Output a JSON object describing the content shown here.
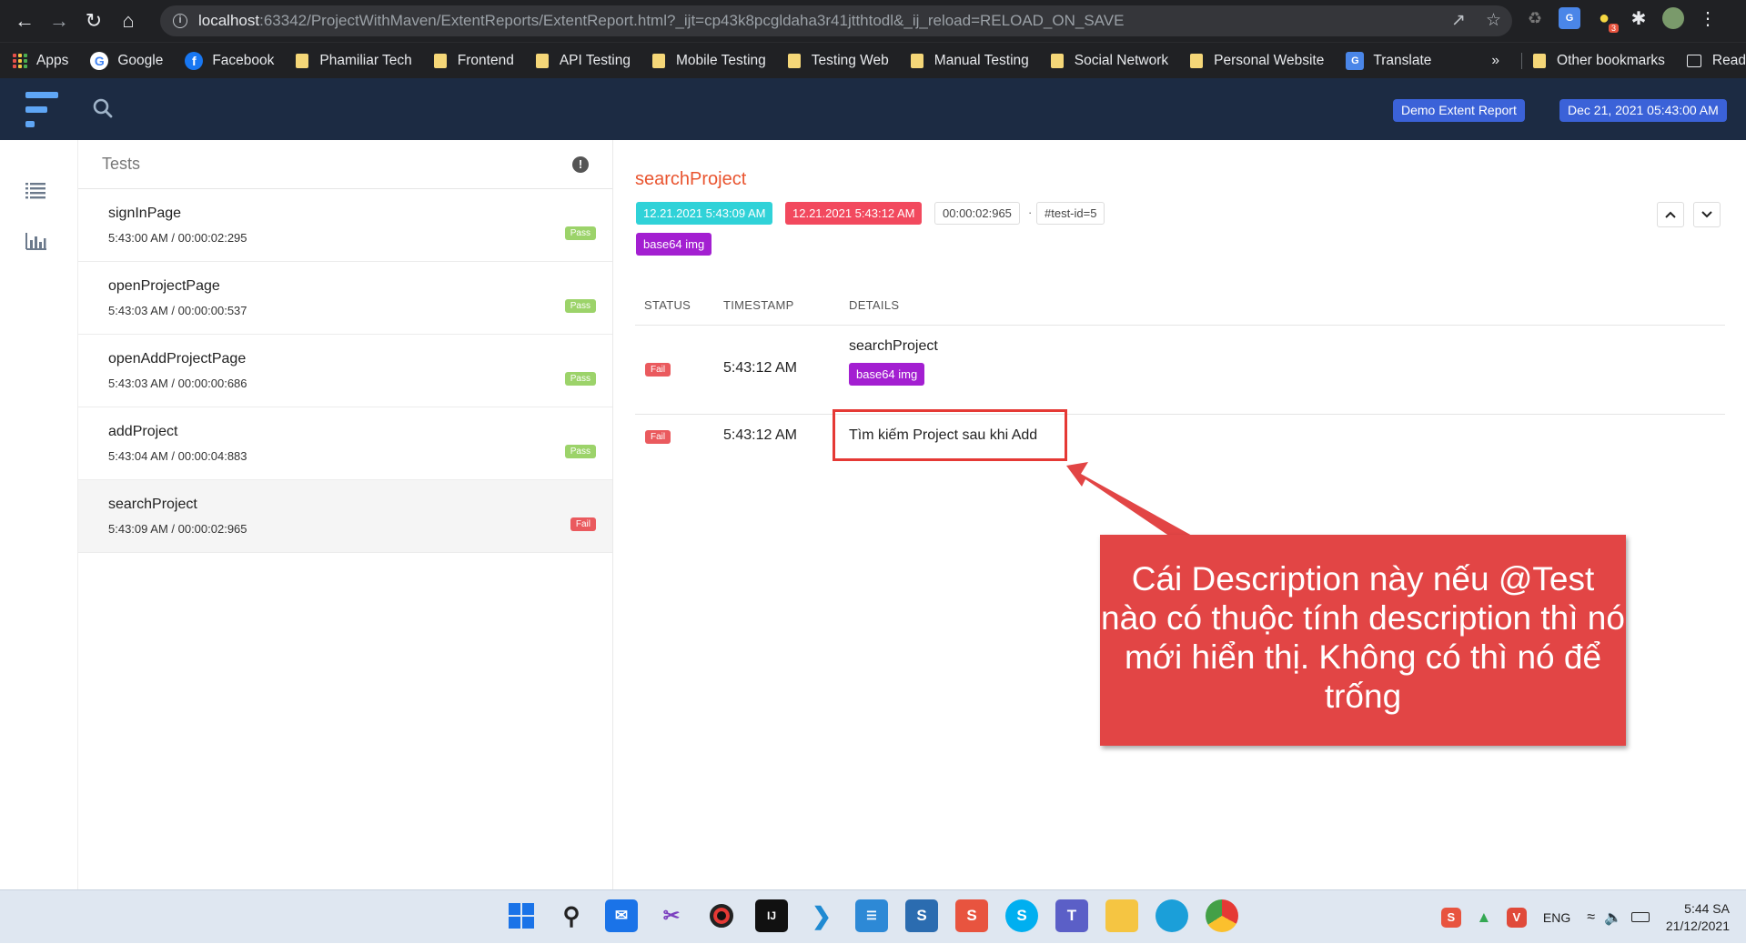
{
  "browser": {
    "url_host": "localhost",
    "url_rest": ":63342/ProjectWithMaven/ExtentReports/ExtentReport.html?_ijt=cp43k8pcgldaha3r41jtthtodl&_ij_reload=RELOAD_ON_SAVE",
    "ext_badge": "3"
  },
  "bookmarks": {
    "apps": "Apps",
    "google": "Google",
    "facebook": "Facebook",
    "items": [
      "Phamiliar Tech",
      "Frontend",
      "API Testing",
      "Mobile Testing",
      "Testing Web",
      "Manual Testing",
      "Social Network",
      "Personal Website"
    ],
    "translate": "Translate",
    "more": "»",
    "other": "Other bookmarks",
    "reading": "Reading list"
  },
  "header": {
    "report_name": "Demo Extent Report",
    "report_date": "Dec 21, 2021 05:43:00 AM"
  },
  "tests_panel": {
    "title": "Tests",
    "tests": [
      {
        "name": "signInPage",
        "meta": "5:43:00 AM / 00:00:02:295",
        "status": "Pass"
      },
      {
        "name": "openProjectPage",
        "meta": "5:43:03 AM / 00:00:00:537",
        "status": "Pass"
      },
      {
        "name": "openAddProjectPage",
        "meta": "5:43:03 AM / 00:00:00:686",
        "status": "Pass"
      },
      {
        "name": "addProject",
        "meta": "5:43:04 AM / 00:00:04:883",
        "status": "Pass"
      },
      {
        "name": "searchProject",
        "meta": "5:43:09 AM / 00:00:02:965",
        "status": "Fail"
      }
    ]
  },
  "detail": {
    "title": "searchProject",
    "start": "12.21.2021 5:43:09 AM",
    "end": "12.21.2021 5:43:12 AM",
    "duration": "00:00:02:965",
    "dot": "·",
    "test_id": "#test-id=5",
    "media_tag": "base64 img",
    "col_status": "STATUS",
    "col_timestamp": "TIMESTAMP",
    "col_details": "DETAILS",
    "logs": [
      {
        "status": "Fail",
        "time": "5:43:12 AM",
        "details": "searchProject",
        "tag": "base64 img"
      },
      {
        "status": "Fail",
        "time": "5:43:12 AM",
        "details": "Tìm kiếm Project sau khi Add"
      }
    ]
  },
  "annotation": {
    "text": "Cái Description này nếu @Test nào có thuộc tính description thì nó mới hiển thị. Không có thì nó để trống"
  },
  "taskbar": {
    "lang": "ENG",
    "time": "5:44 SA",
    "date": "21/12/2021"
  }
}
